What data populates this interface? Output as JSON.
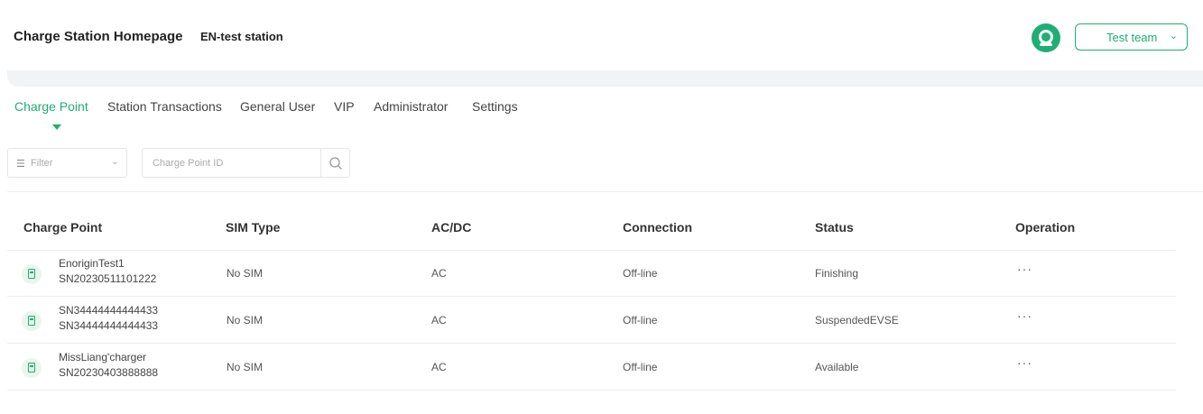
{
  "header": {
    "title": "Charge Station Homepage",
    "station": "EN-test station",
    "team_label": "Test team",
    "accent_color": "#1fae73"
  },
  "tabs": [
    {
      "label": "Charge Point",
      "active": true
    },
    {
      "label": "Station Transactions",
      "active": false
    },
    {
      "label": "General User",
      "active": false
    },
    {
      "label": "VIP",
      "active": false
    },
    {
      "label": "Administrator",
      "active": false
    },
    {
      "label": "Settings",
      "active": false
    }
  ],
  "filter": {
    "placeholder": "Filter"
  },
  "search": {
    "placeholder": "Charge Point ID"
  },
  "table": {
    "columns": [
      "Charge Point",
      "SIM Type",
      "AC/DC",
      "Connection",
      "Status",
      "Operation"
    ],
    "rows": [
      {
        "name": "EnoriginTest1",
        "sn": "SN20230511101222",
        "sim": "No SIM",
        "acdc": "AC",
        "connection": "Off-line",
        "status": "Finishing",
        "operation": "···"
      },
      {
        "name": "SN34444444444433",
        "sn": "SN34444444444433",
        "sim": "No SIM",
        "acdc": "AC",
        "connection": "Off-line",
        "status": "SuspendedEVSE",
        "operation": "···"
      },
      {
        "name": "MissLiang'charger",
        "sn": "SN20230403888888",
        "sim": "No SIM",
        "acdc": "AC",
        "connection": "Off-line",
        "status": "Available",
        "operation": "···"
      }
    ]
  }
}
